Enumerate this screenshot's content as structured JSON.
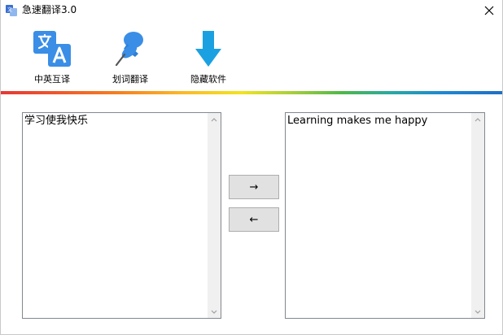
{
  "window": {
    "title": "急速翻译3.0"
  },
  "toolbar": {
    "items": [
      {
        "label": "中英互译",
        "icon": "translate-icon"
      },
      {
        "label": "划词翻译",
        "icon": "pushpin-icon"
      },
      {
        "label": "隐藏软件",
        "icon": "arrow-down-icon"
      }
    ]
  },
  "source": {
    "text": "学习使我快乐"
  },
  "target": {
    "text": "Learning makes me happy"
  },
  "buttons": {
    "to_right": "→",
    "to_left": "←"
  },
  "colors": {
    "icon_blue": "#3a8ee6",
    "accent_blue": "#1e88d3"
  }
}
